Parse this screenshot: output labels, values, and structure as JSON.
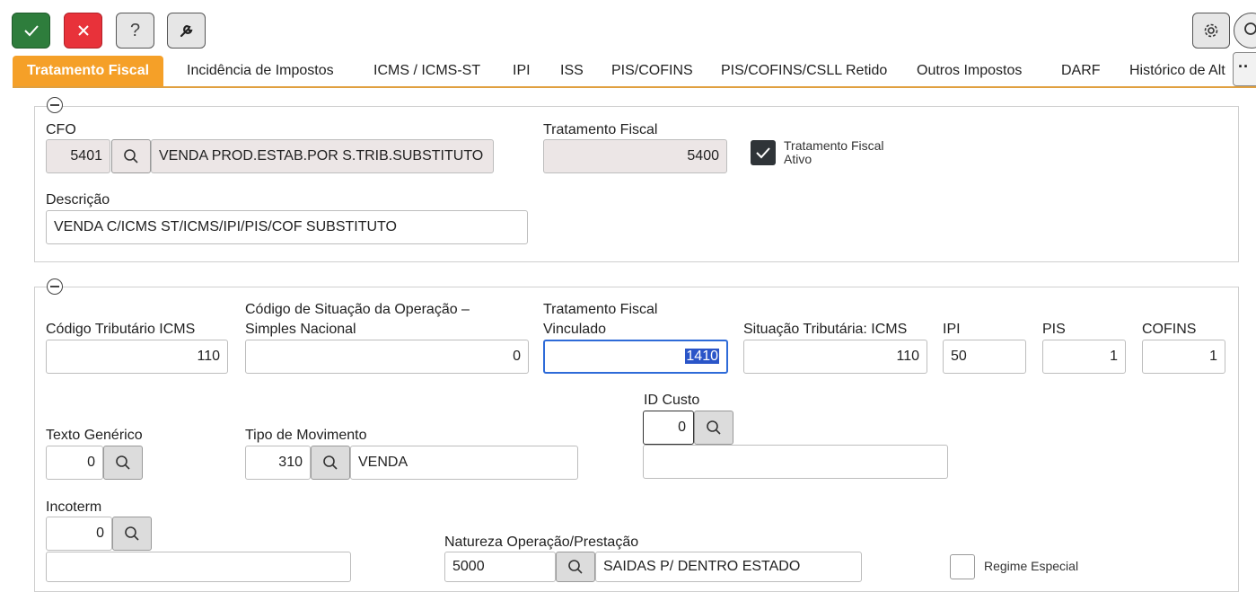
{
  "toolbar": {
    "confirm_icon": "check-icon",
    "cancel_icon": "close-icon",
    "help_label": "?",
    "tools_icon": "wrench-icon",
    "settings_icon": "gear-icon",
    "search_icon": "search-icon"
  },
  "tabs": [
    {
      "label": "Tratamento Fiscal",
      "active": true
    },
    {
      "label": "Incidência de Impostos"
    },
    {
      "label": "ICMS / ICMS-ST"
    },
    {
      "label": "IPI"
    },
    {
      "label": "ISS"
    },
    {
      "label": "PIS/COFINS"
    },
    {
      "label": "PIS/COFINS/CSLL Retido"
    },
    {
      "label": "Outros Impostos"
    },
    {
      "label": "DARF"
    },
    {
      "label": "Histórico de Alt"
    }
  ],
  "more_label": "··",
  "section1": {
    "cfo": {
      "label": "CFO",
      "code": "5401",
      "description": "VENDA PROD.ESTAB.POR S.TRIB.SUBSTITUTO"
    },
    "tratamento_fiscal": {
      "label": "Tratamento Fiscal",
      "value": "5400"
    },
    "ativo": {
      "label_line1": "Tratamento Fiscal",
      "label_line2": "Ativo",
      "checked": true
    },
    "descricao": {
      "label": "Descrição",
      "value": "VENDA C/ICMS ST/ICMS/IPI/PIS/COF SUBSTITUTO"
    }
  },
  "section2": {
    "codigo_tributario": {
      "label": "Código Tributário ICMS",
      "value": "110"
    },
    "csosn": {
      "label_line1": "Código de Situação da Operação –",
      "label_line2": "Simples Nacional",
      "value": "0"
    },
    "tf_vinculado": {
      "label_line1": "Tratamento Fiscal",
      "label_line2": "Vinculado",
      "value": "1410"
    },
    "situacao_icms": {
      "label": "Situação Tributária: ICMS",
      "value": "110"
    },
    "ipi": {
      "label": "IPI",
      "value": "50"
    },
    "pis": {
      "label": "PIS",
      "value": "1"
    },
    "cofins": {
      "label": "COFINS",
      "value": "1"
    },
    "id_custo": {
      "label": "ID Custo",
      "value": "0",
      "description": ""
    },
    "texto_generico": {
      "label": "Texto Genérico",
      "value": "0"
    },
    "tipo_movimento": {
      "label": "Tipo de Movimento",
      "value": "310",
      "description": "VENDA"
    },
    "incoterm": {
      "label": "Incoterm",
      "value": "0",
      "description": ""
    },
    "natureza": {
      "label": "Natureza Operação/Prestação",
      "value": "5000",
      "description": "SAIDAS P/ DENTRO ESTADO"
    },
    "regime_especial": {
      "label": "Regime Especial",
      "checked": false
    }
  },
  "colors": {
    "accent": "#f5a028",
    "confirm": "#2e7d3c",
    "cancel": "#e8323a",
    "focus": "#2e6bd8"
  }
}
